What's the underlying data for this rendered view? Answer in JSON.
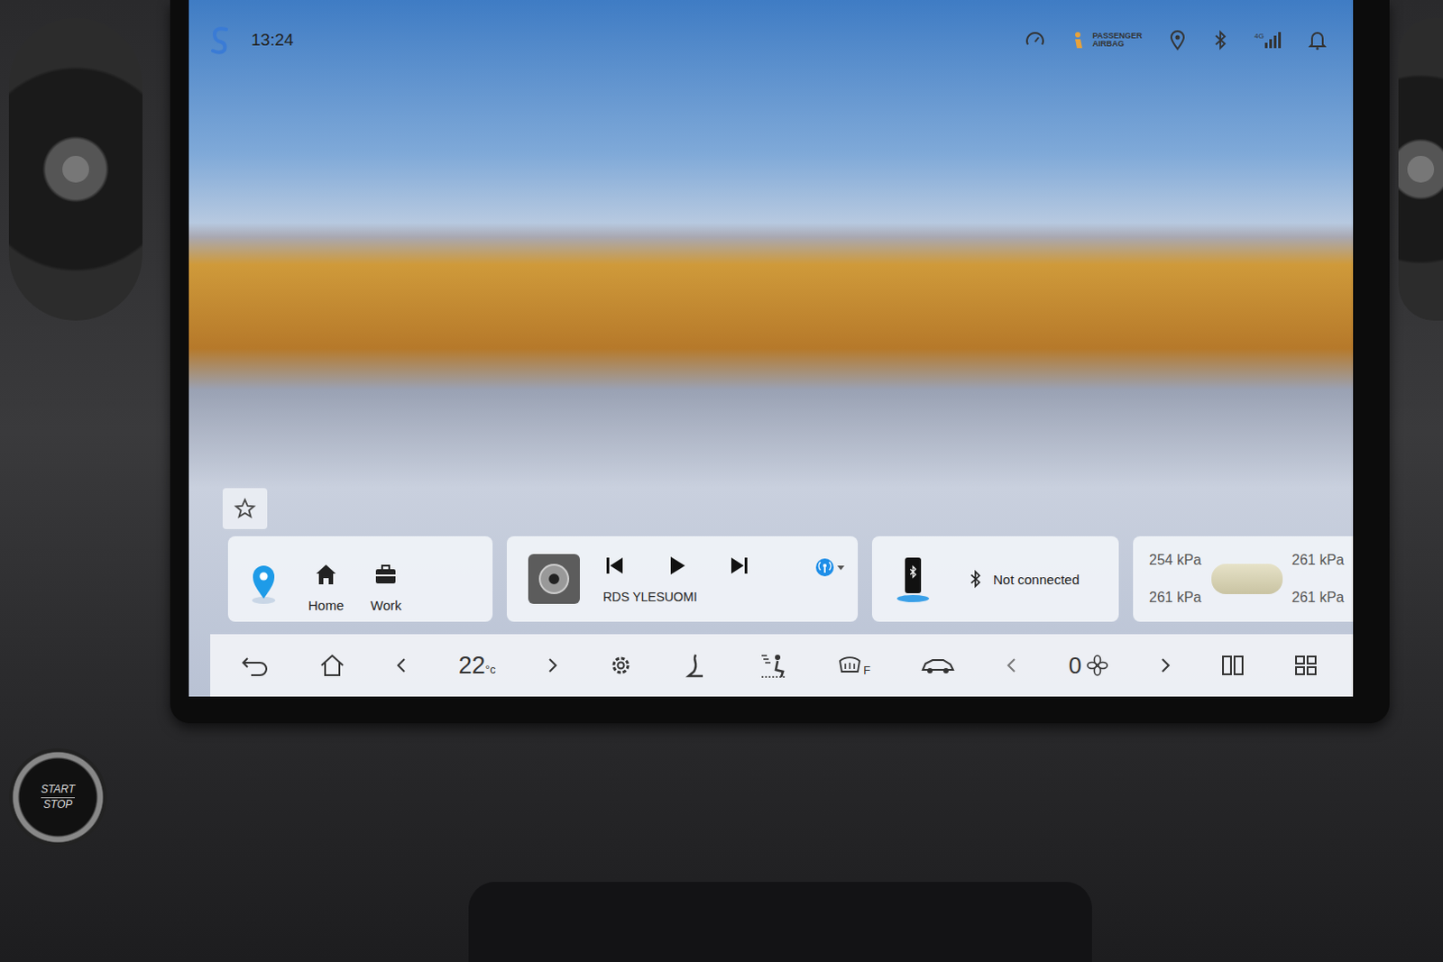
{
  "status_bar": {
    "time": "13:24",
    "airbag": [
      "PASSENGER",
      "AIRBAG"
    ],
    "network": "4G"
  },
  "nav_card": {
    "shortcuts": [
      {
        "label": "Home",
        "kind": "home"
      },
      {
        "label": "Work",
        "kind": "work"
      }
    ]
  },
  "media_card": {
    "station": "RDS YLESUOMI",
    "playing": false
  },
  "phone_card": {
    "status": "Not connected"
  },
  "tire_card": {
    "pressures": [
      "254 kPa",
      "261 kPa",
      "261 kPa",
      "261 kPa"
    ]
  },
  "climate_bar": {
    "temperature": "22",
    "unit": "°c",
    "defrost_label": "F",
    "fan_speed": "0"
  },
  "start_button": {
    "lines": [
      "START",
      "STOP"
    ]
  }
}
